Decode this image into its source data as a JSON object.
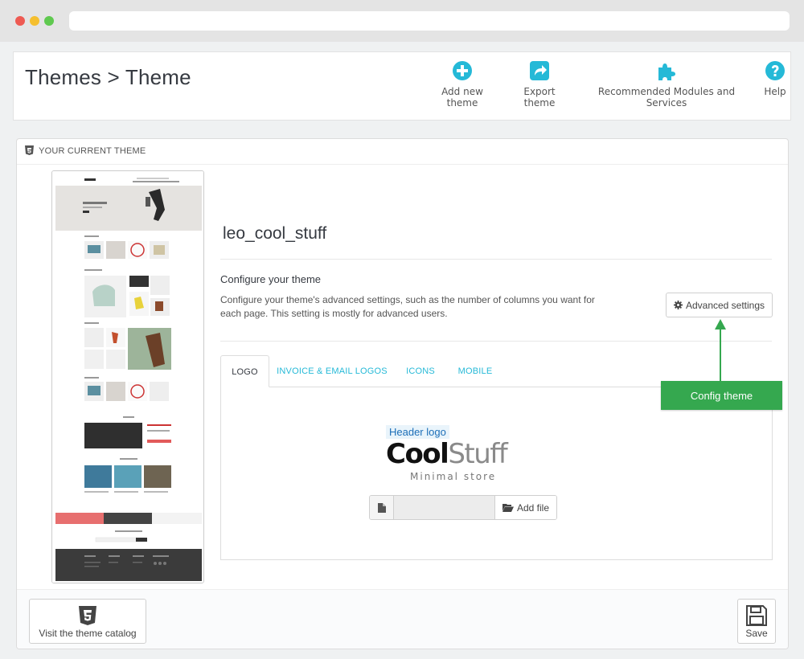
{
  "header": {
    "title": "Themes > Theme",
    "toolbar": [
      {
        "label": "Add new theme",
        "icon": "plus-circle-icon"
      },
      {
        "label": "Export theme",
        "icon": "share-icon"
      },
      {
        "label": "Recommended Modules and Services",
        "icon": "puzzle-icon"
      },
      {
        "label": "Help",
        "icon": "help-icon"
      }
    ]
  },
  "panel": {
    "heading": "YOUR CURRENT THEME",
    "theme_name": "leo_cool_stuff",
    "configure_title": "Configure your theme",
    "configure_desc": "Configure your theme's advanced settings, such as the number of columns you want for each page. This setting is mostly for advanced users.",
    "advanced_button": "Advanced settings",
    "tabs": [
      {
        "label": "LOGO",
        "active": true
      },
      {
        "label": "INVOICE & EMAIL LOGOS",
        "active": false
      },
      {
        "label": "ICONS",
        "active": false
      },
      {
        "label": "MOBILE",
        "active": false
      }
    ],
    "logo": {
      "label": "Header logo",
      "brand_bold": "Cool",
      "brand_light": "Stuff",
      "tagline": "Minimal store"
    },
    "add_file": "Add file",
    "annotation": "Config theme"
  },
  "footer": {
    "catalog_button": "Visit the theme catalog",
    "save_button": "Save"
  },
  "colors": {
    "accent": "#25b9d7",
    "callout": "#35a84f",
    "text": "#363a41"
  }
}
